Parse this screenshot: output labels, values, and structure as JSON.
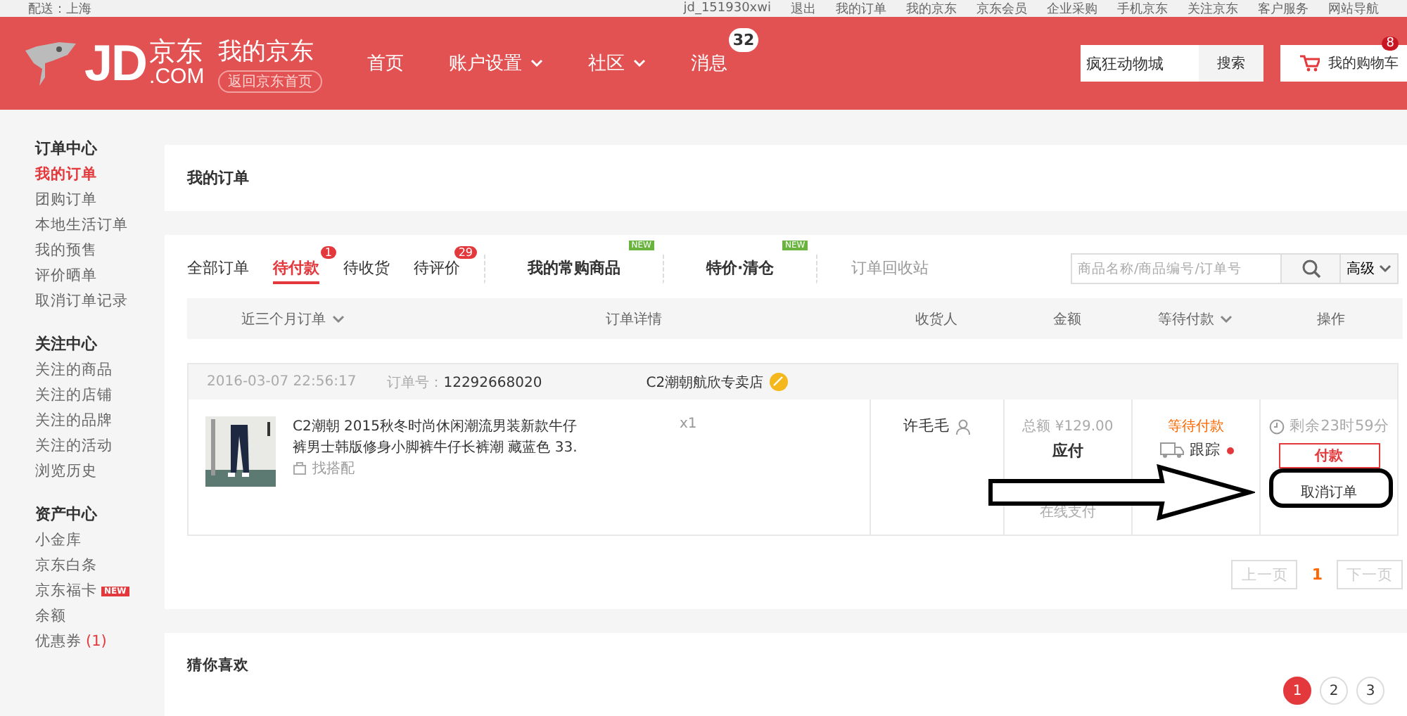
{
  "top_bar": {
    "location": "配送：上海",
    "links": [
      "jd_151930xwi",
      "退出",
      "我的订单",
      "我的京东",
      "京东会员",
      "企业采购",
      "手机京东",
      "关注京东",
      "客户服务",
      "网站导航"
    ]
  },
  "header": {
    "logo": {
      "letters": "JD",
      "cn": "京东",
      "domain": ".COM"
    },
    "title": "我的京东",
    "home_link": "返回京东首页",
    "nav": [
      {
        "label": "首页",
        "dropdown": false
      },
      {
        "label": "账户设置",
        "dropdown": true
      },
      {
        "label": "社区",
        "dropdown": true
      },
      {
        "label": "消息",
        "dropdown": false,
        "badge": "32"
      }
    ],
    "search": {
      "value": "疯狂动物城",
      "button": "搜索"
    },
    "cart": {
      "label": "我的购物车",
      "badge": "8"
    }
  },
  "sidebar": [
    {
      "title": "订单中心",
      "items": [
        {
          "label": "我的订单",
          "selected": true
        },
        {
          "label": "团购订单",
          "selected": false
        },
        {
          "label": "本地生活订单",
          "selected": false
        },
        {
          "label": "我的预售",
          "selected": false
        },
        {
          "label": "评价晒单",
          "selected": false
        },
        {
          "label": "取消订单记录",
          "selected": false
        }
      ]
    },
    {
      "title": "关注中心",
      "items": [
        {
          "label": "关注的商品",
          "selected": false
        },
        {
          "label": "关注的店铺",
          "selected": false
        },
        {
          "label": "关注的品牌",
          "selected": false
        },
        {
          "label": "关注的活动",
          "selected": false
        },
        {
          "label": "浏览历史",
          "selected": false
        }
      ]
    },
    {
      "title": "资产中心",
      "items": [
        {
          "label": "小金库",
          "selected": false
        },
        {
          "label": "京东白条",
          "selected": false
        },
        {
          "label": "京东福卡",
          "selected": false,
          "tag": "NEW"
        },
        {
          "label": "余额",
          "selected": false
        },
        {
          "label": "优惠券",
          "selected": false,
          "count": "(1)"
        }
      ]
    }
  ],
  "page_title": "我的订单",
  "tabs": [
    {
      "kind": "status",
      "label": "全部订单",
      "selected": false
    },
    {
      "kind": "status",
      "label": "待付款",
      "selected": true,
      "badge": "1"
    },
    {
      "kind": "status",
      "label": "待收货",
      "selected": false
    },
    {
      "kind": "status",
      "label": "待评价",
      "selected": false,
      "badge": "29"
    },
    {
      "kind": "feature",
      "label": "我的常购商品",
      "selected": false,
      "tag": "NEW"
    },
    {
      "kind": "feature",
      "label": "特价·清仓",
      "selected": false,
      "tag": "NEW"
    },
    {
      "kind": "link",
      "label": "订单回收站",
      "selected": false
    }
  ],
  "order_search": {
    "placeholder": "商品名称/商品编号/订单号",
    "advanced": "高级"
  },
  "table": {
    "columns": [
      {
        "label": "近三个月订单",
        "dropdown": true
      },
      {
        "label": "订单详情",
        "dropdown": false
      },
      {
        "label": "收货人",
        "dropdown": false
      },
      {
        "label": "金额",
        "dropdown": false
      },
      {
        "label": "等待付款",
        "dropdown": true
      },
      {
        "label": "操作",
        "dropdown": false
      }
    ],
    "orders": [
      {
        "date": "2016-03-07 22:56:17",
        "number_label": "订单号：",
        "number": "12292668020",
        "shop": "C2潮朝航欣专卖店",
        "product": {
          "title": "C2潮朝 2015秋冬时尚休闲潮流男装新款牛仔裤男士韩版修身小脚裤牛仔长裤潮 藏蓝色 33.",
          "match": "找搭配",
          "quantity": "x1"
        },
        "receiver": "许毛毛",
        "total": "总额 ¥129.00",
        "due_label": "应付",
        "payment": "在线支付",
        "status": "等待付款",
        "track": "跟踪",
        "remaining": "剩余23时59分",
        "pay_button": "付款",
        "cancel_button": "取消订单"
      }
    ]
  },
  "pagination": {
    "prev": "上一页",
    "current": "1",
    "next": "下一页"
  },
  "recommend": {
    "title": "猜你喜欢",
    "pages": [
      {
        "label": "1",
        "selected": true
      },
      {
        "label": "2",
        "selected": false
      },
      {
        "label": "3",
        "selected": false
      }
    ]
  }
}
